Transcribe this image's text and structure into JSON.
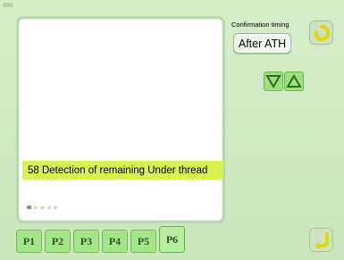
{
  "screen": {
    "message": "58 Detection of remaining Under thread",
    "page_indicator": {
      "total": 5,
      "active": 1
    }
  },
  "confirmation": {
    "label": "Confirmation timing",
    "value": "After ATH"
  },
  "controls": {
    "down_icon": "triangle-down-icon",
    "up_icon": "triangle-up-icon",
    "undo_icon": "undo-icon",
    "enter_icon": "enter-icon"
  },
  "tabs": [
    {
      "label": "P1"
    },
    {
      "label": "P2"
    },
    {
      "label": "P3"
    },
    {
      "label": "P4"
    },
    {
      "label": "P5"
    },
    {
      "label": "P6"
    }
  ],
  "active_tab": "P6",
  "colors": {
    "background": "#cfe8c4",
    "message_highlight": "#d9f24d",
    "button_green": "#a6e48a"
  }
}
